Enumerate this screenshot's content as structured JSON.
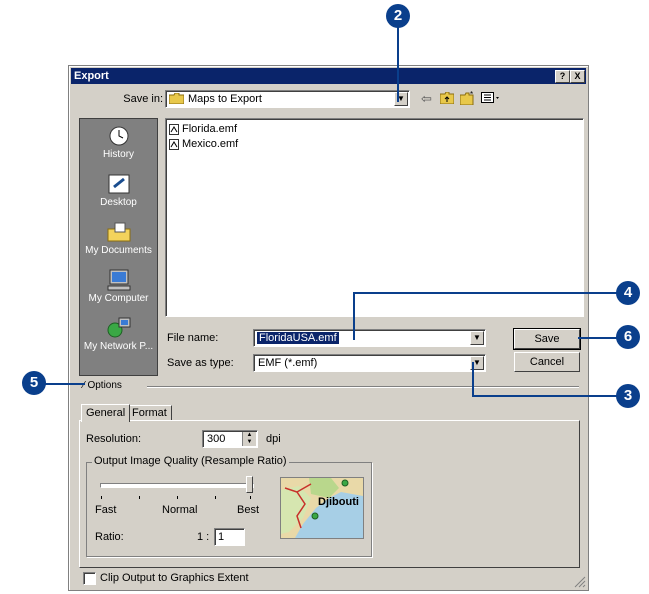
{
  "dialog": {
    "title": "Export",
    "help_btn": "?",
    "close_btn": "X",
    "save_in_label": "Save in:",
    "save_in_value": "Maps to Export"
  },
  "places": [
    {
      "label": "History",
      "icon": "history-icon"
    },
    {
      "label": "Desktop",
      "icon": "desktop-icon"
    },
    {
      "label": "My Documents",
      "icon": "my-documents-icon"
    },
    {
      "label": "My Computer",
      "icon": "my-computer-icon"
    },
    {
      "label": "My Network P...",
      "icon": "my-network-places-icon"
    }
  ],
  "files": [
    {
      "name": "Florida.emf"
    },
    {
      "name": "Mexico.emf"
    }
  ],
  "form": {
    "file_name_label": "File name:",
    "file_name_value": "FloridaUSA.emf",
    "save_as_type_label": "Save as type:",
    "save_as_type_value": "EMF (*.emf)",
    "save_button": "Save",
    "cancel_button": "Cancel"
  },
  "options": {
    "label": "Options",
    "tabs": [
      "General",
      "Format"
    ],
    "resolution_label": "Resolution:",
    "resolution_value": "300",
    "resolution_unit": "dpi",
    "quality_group": "Output Image Quality (Resample Ratio)",
    "slider_fast": "Fast",
    "slider_normal": "Normal",
    "slider_best": "Best",
    "slider_level": "Best",
    "ratio_label": "Ratio:",
    "ratio_prefix": "1 :",
    "ratio_value": "1",
    "preview_label": "Djibouti",
    "clip_checkbox": "Clip Output to Graphics Extent"
  },
  "callouts": [
    "2",
    "3",
    "4",
    "5",
    "6"
  ],
  "colors": {
    "callout": "#0a3f8c",
    "titlebar": "#0a246a",
    "selection": "#0a246a"
  }
}
